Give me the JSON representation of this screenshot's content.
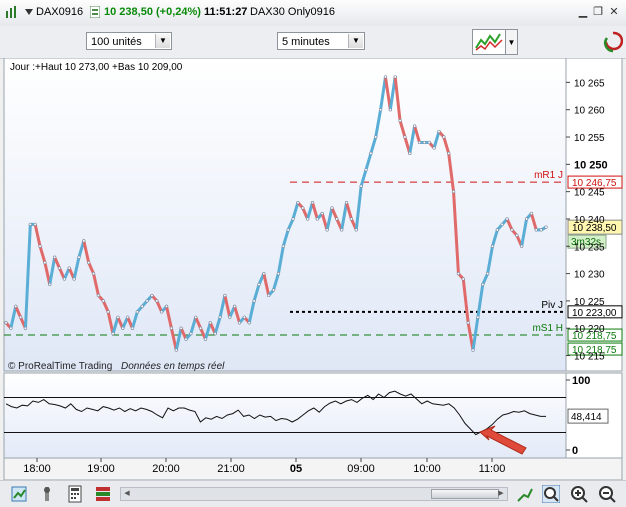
{
  "titlebar": {
    "symbol": "DAX0916",
    "quote": "10 238,50 (+0,24%)",
    "time": "11:51:27",
    "instrument": "DAX30 Only0916",
    "quote_color": "#0a8a0a"
  },
  "toolbar": {
    "units_select": "100 unités",
    "timeframe_select": "5 minutes"
  },
  "chart": {
    "header": "Jour :+Haut 10 273,00 +Bas 10 209,00",
    "watermark": "© ProRealTime Trading",
    "watermark_note": "Données en temps réel",
    "y_ticks": [
      "10 265",
      "10 260",
      "10 255",
      "10 250",
      "10 245",
      "10 240",
      "10 235",
      "10 230",
      "10 225",
      "10 220",
      "10 215"
    ],
    "y_tick_values": [
      10265,
      10260,
      10255,
      10250,
      10245,
      10240,
      10235,
      10230,
      10225,
      10220,
      10215
    ],
    "y_range": [
      10214,
      10268
    ],
    "x_labels": [
      "18:00",
      "19:00",
      "20:00",
      "21:00",
      "05",
      "09:00",
      "10:00",
      "11:00"
    ],
    "levels": [
      {
        "name": "mR1 J",
        "value_label": "10 246,75",
        "value": 10246.75,
        "color": "#d01010",
        "style": "dashed"
      },
      {
        "name": "Piv J",
        "value_label": "10 223,00",
        "value": 10223.0,
        "color": "#000000",
        "style": "dotted"
      },
      {
        "name": "mS1 H",
        "value_label": "10 218,75",
        "value": 10218.75,
        "color": "#0a7a0a",
        "style": "dashed"
      }
    ],
    "extra_level_label": "10 218,75",
    "current_price_label": "10 238,50",
    "current_price": 10238.5,
    "countdown": "3m32s",
    "up_color": "#5aaed6",
    "down_color": "#e06a6a",
    "price_series": [
      10221,
      10220,
      10224,
      10222,
      10220,
      10239,
      10239,
      10235,
      10232,
      10228,
      10233,
      10231,
      10229,
      10231,
      10229,
      10233,
      10236,
      10232,
      10230,
      10226,
      10225,
      10223,
      10219,
      10222,
      10220,
      10222,
      10220,
      10223,
      10224,
      10225,
      10226,
      10225,
      10223,
      10224,
      10220,
      10216,
      10220,
      10218,
      10219,
      10222,
      10220,
      10218,
      10221,
      10219,
      10222,
      10226,
      10222,
      10224,
      10221,
      10222,
      10221,
      10225,
      10228,
      10230,
      10226,
      10227,
      10230,
      10235,
      10238,
      10240,
      10243,
      10242,
      10240,
      10243,
      10240,
      10241,
      10238,
      10242,
      10240,
      10238,
      10243,
      10240,
      10238,
      10246,
      10249,
      10252,
      10255,
      10260,
      10266,
      10260,
      10266,
      10258,
      10255,
      10252,
      10257,
      10254,
      10254,
      10254,
      10253,
      10256,
      10255,
      10252,
      10245,
      10230,
      10229,
      10221,
      10216,
      10222,
      10228,
      10230,
      10235,
      10238,
      10239,
      10240,
      10238,
      10237,
      10235,
      10240,
      10241,
      10238,
      10238,
      10238.5
    ],
    "oscillator": {
      "label": "48,414",
      "value": 48.414,
      "ticks": [
        "100",
        "0"
      ],
      "range": [
        0,
        100
      ],
      "levels": [
        75,
        25
      ],
      "series": [
        66,
        62,
        60,
        64,
        63,
        70,
        68,
        72,
        66,
        65,
        63,
        60,
        66,
        58,
        55,
        60,
        58,
        56,
        62,
        60,
        57,
        60,
        55,
        59,
        56,
        60,
        58,
        55,
        50,
        46,
        60,
        56,
        60,
        60,
        57,
        55,
        40,
        46,
        44,
        48,
        45,
        50,
        52,
        57,
        48,
        50,
        45,
        50,
        47,
        48,
        42,
        45,
        44,
        40,
        44,
        50,
        56,
        60,
        54,
        62,
        67,
        70,
        66,
        70,
        72,
        68,
        74,
        78,
        72,
        80,
        75,
        82,
        84,
        80,
        77,
        80,
        73,
        66,
        70,
        66,
        65,
        64,
        66,
        60,
        50,
        38,
        30,
        22,
        26,
        30,
        36,
        44,
        50,
        52,
        55,
        54,
        56,
        52,
        50,
        48,
        48
      ]
    }
  },
  "statusbar": {}
}
